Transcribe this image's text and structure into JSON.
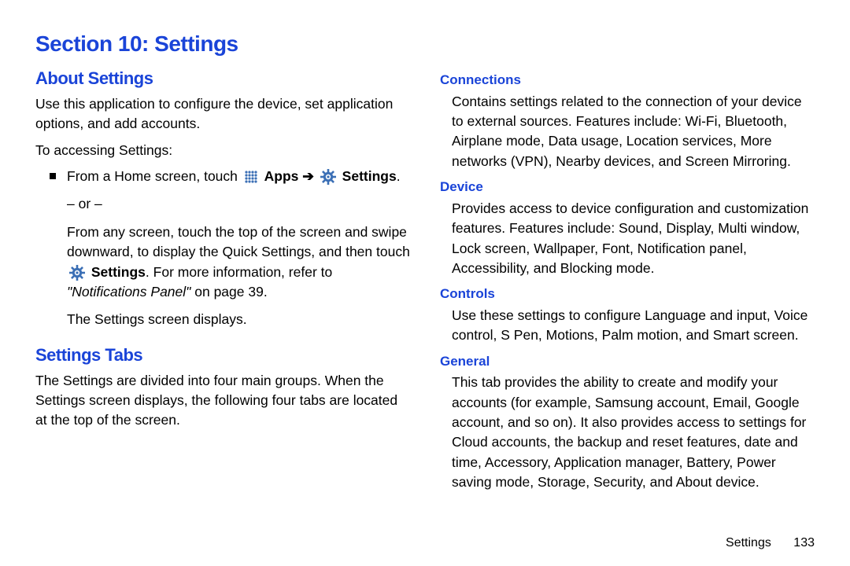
{
  "section_title": "Section 10: Settings",
  "about": {
    "heading": "About Settings",
    "intro": "Use this application to configure the device, set application options, and add accounts.",
    "access_label": "To accessing Settings:",
    "instr_line1_a": "From a Home screen, touch ",
    "apps_label": "Apps",
    "arrow": "➔",
    "settings_label": "Settings",
    "instr_line1_b": ".",
    "or_text": "– or –",
    "instr_line2_a": "From any screen, touch the top of the screen and swipe downward, to display the Quick Settings, and then touch ",
    "instr_line2_b": ". For more information, refer to ",
    "ref_italic": "\"Notifications Panel\"",
    "ref_tail": " on page 39.",
    "displays": "The Settings screen displays."
  },
  "tabs": {
    "heading": "Settings Tabs",
    "intro": "The Settings are divided into four main groups. When the Settings screen displays, the following four tabs are located at the top of the screen."
  },
  "connections": {
    "heading": "Connections",
    "body": "Contains settings related to the connection of your device to external sources. Features include: Wi-Fi, Bluetooth, Airplane mode, Data usage, Location services, More networks (VPN), Nearby devices, and Screen Mirroring."
  },
  "device": {
    "heading": "Device",
    "body": "Provides access to device configuration and customization features. Features include: Sound, Display, Multi window, Lock screen, Wallpaper, Font, Notification panel, Accessibility, and Blocking mode."
  },
  "controls": {
    "heading": "Controls",
    "body": "Use these settings to configure Language and input, Voice control, S Pen, Motions, Palm motion, and Smart screen."
  },
  "general": {
    "heading": "General",
    "body": "This tab provides the ability to create and modify your accounts (for example, Samsung account, Email, Google account, and so on). It also provides access to settings for Cloud accounts, the backup and reset features, date and time, Accessory, Application manager, Battery, Power saving mode, Storage, Security, and About device."
  },
  "footer": {
    "label": "Settings",
    "page": "133"
  }
}
